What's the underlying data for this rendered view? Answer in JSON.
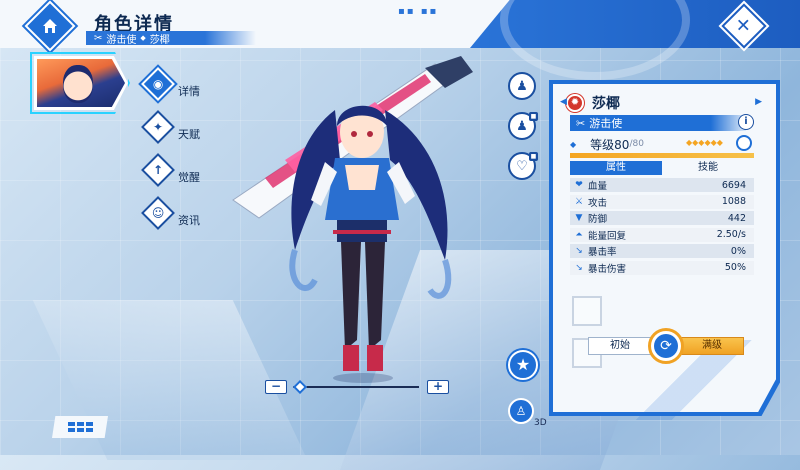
{
  "header": {
    "title": "角色详情",
    "crumb_class": "游击使",
    "crumb_name": "莎椰"
  },
  "nav": [
    {
      "label": "详情",
      "icon": "location-pin-icon"
    },
    {
      "label": "天赋",
      "icon": "talent-icon"
    },
    {
      "label": "觉醒",
      "icon": "awaken-arrow-icon"
    },
    {
      "label": "资讯",
      "icon": "info-face-icon"
    }
  ],
  "zoom": {
    "minus": "−",
    "plus": "+",
    "level": 0.05
  },
  "character": {
    "name": "莎椰",
    "class": "游击使",
    "level_label": "等级80",
    "level_max": "/80",
    "stars": "◆◆◆◆◆◆",
    "exp_fraction": 1.0,
    "element_color": "#d3372c"
  },
  "tabs": {
    "attributes": "属性",
    "skills": "技能"
  },
  "stats": [
    {
      "label": "血量",
      "value": "6694",
      "icon": "heart-icon"
    },
    {
      "label": "攻击",
      "value": "1088",
      "icon": "sword-icon"
    },
    {
      "label": "防御",
      "value": "442",
      "icon": "shield-icon"
    },
    {
      "label": "能量回复",
      "value": "2.50/s",
      "icon": "energy-icon"
    },
    {
      "label": "暴击率",
      "value": "0%",
      "icon": "crit-icon"
    },
    {
      "label": "暴击伤害",
      "value": "50%",
      "icon": "crit-damage-icon"
    }
  ],
  "buttons": {
    "initial": "初始",
    "max": "满级",
    "view3d": "3D"
  },
  "colors": {
    "accent": "#1f6fd6",
    "gold": "#f0a224",
    "dark": "#0e2a52"
  }
}
